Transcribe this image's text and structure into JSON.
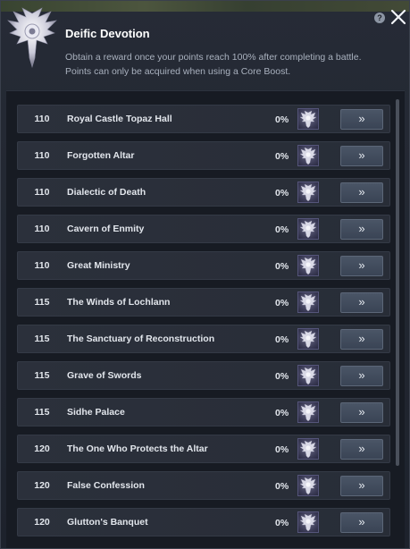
{
  "window": {
    "title": "Deific Devotion",
    "description_line1": "Obtain a reward once your points reach 100% after completing a battle.",
    "description_line2": "Points can only be acquired when using a Core Boost.",
    "help_label": "?"
  },
  "go_button_label": "»",
  "rows": [
    {
      "level": "110",
      "name": "Royal Castle Topaz Hall",
      "progress": "0%"
    },
    {
      "level": "110",
      "name": "Forgotten Altar",
      "progress": "0%"
    },
    {
      "level": "110",
      "name": "Dialectic of Death",
      "progress": "0%"
    },
    {
      "level": "110",
      "name": "Cavern of Enmity",
      "progress": "0%"
    },
    {
      "level": "110",
      "name": "Great Ministry",
      "progress": "0%"
    },
    {
      "level": "115",
      "name": "The Winds of Lochlann",
      "progress": "0%"
    },
    {
      "level": "115",
      "name": "The Sanctuary of Reconstruction",
      "progress": "0%"
    },
    {
      "level": "115",
      "name": "Grave of Swords",
      "progress": "0%"
    },
    {
      "level": "115",
      "name": "Sidhe Palace",
      "progress": "0%"
    },
    {
      "level": "120",
      "name": "The One Who Protects the Altar",
      "progress": "0%"
    },
    {
      "level": "120",
      "name": "False Confession",
      "progress": "0%"
    },
    {
      "level": "120",
      "name": "Glutton's Banquet",
      "progress": "0%"
    }
  ],
  "icons": {
    "emblem": "winged-emblem-icon",
    "help": "help-icon",
    "close": "close-icon",
    "reward": "reward-icon"
  }
}
